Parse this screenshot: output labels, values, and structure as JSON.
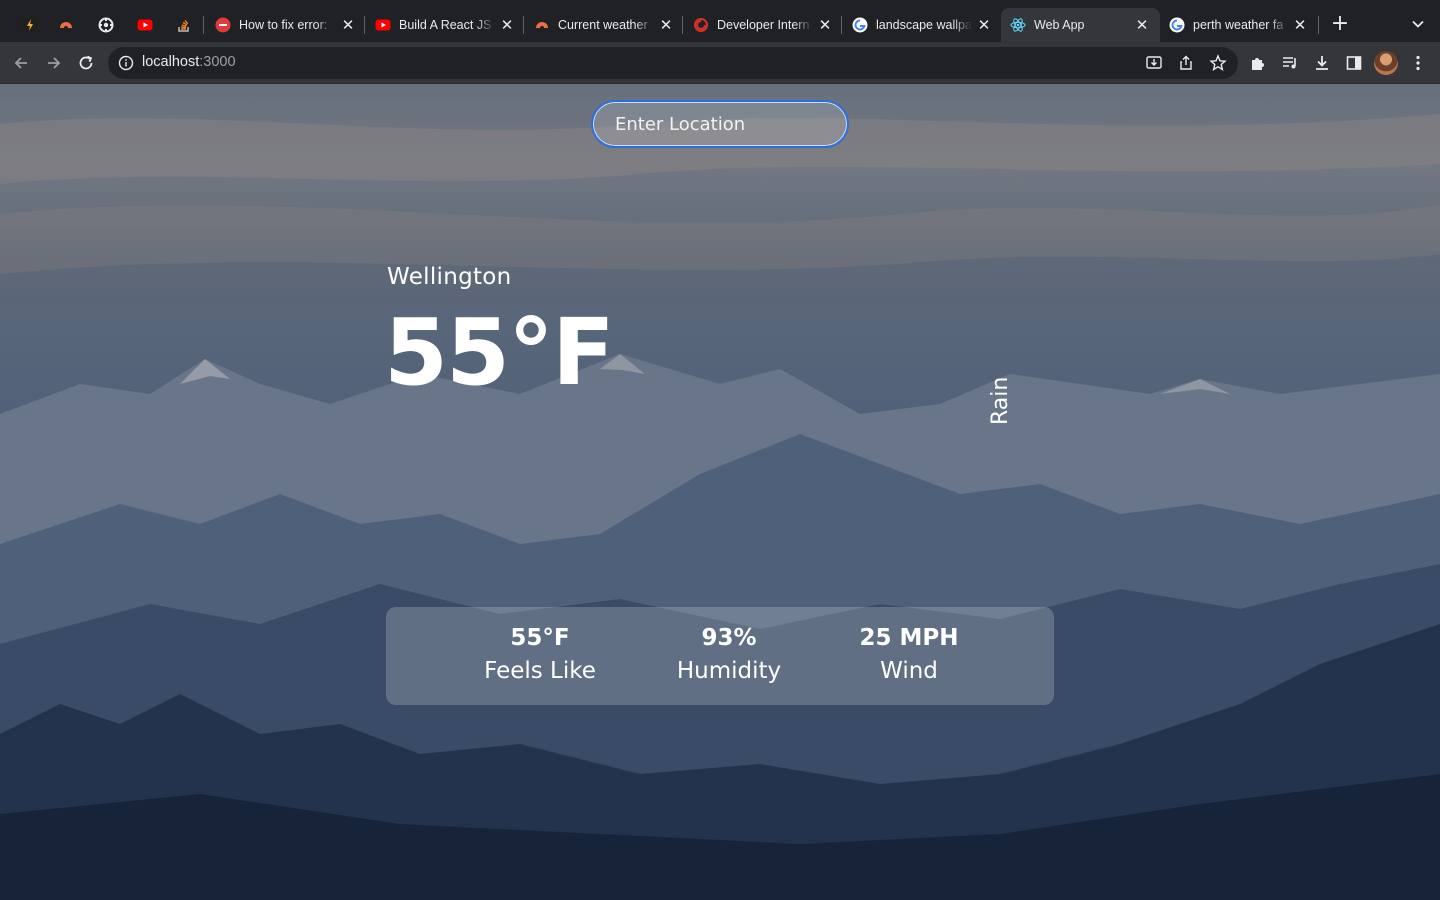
{
  "browser": {
    "tabs": [
      {
        "title": "",
        "icon": "bolt-app-icon",
        "pinned": true
      },
      {
        "title": "",
        "icon": "openweather-icon",
        "pinned": true
      },
      {
        "title": "",
        "icon": "settings-app-icon",
        "pinned": true
      },
      {
        "title": "",
        "icon": "youtube-icon",
        "pinned": true
      },
      {
        "title": "",
        "icon": "stackoverflow-icon",
        "pinned": true
      },
      {
        "title": "How to fix error:",
        "icon": "red-circle-icon",
        "pinned": false
      },
      {
        "title": "Build A React JS",
        "icon": "youtube-icon",
        "pinned": false
      },
      {
        "title": "Current weather",
        "icon": "openweather-icon",
        "pinned": false
      },
      {
        "title": "Developer Intern",
        "icon": "red-swirl-icon",
        "pinned": false
      },
      {
        "title": "landscape wallpa",
        "icon": "google-icon",
        "pinned": false
      },
      {
        "title": "Web App",
        "icon": "react-icon",
        "pinned": false,
        "active": true
      },
      {
        "title": "perth weather fa",
        "icon": "google-icon",
        "pinned": false
      }
    ],
    "url_host": "localhost",
    "url_port": ":3000"
  },
  "app": {
    "search_placeholder": "Enter Location",
    "city": "Wellington",
    "temperature": "55°F",
    "condition": "Rain",
    "stats": [
      {
        "value": "55°F",
        "label": "Feels Like"
      },
      {
        "value": "93%",
        "label": "Humidity"
      },
      {
        "value": "25 MPH",
        "label": "Wind"
      }
    ]
  },
  "colors": {
    "tab_strip": "#202124",
    "toolbar": "#35363a",
    "search_border": "#2f6fd8"
  }
}
